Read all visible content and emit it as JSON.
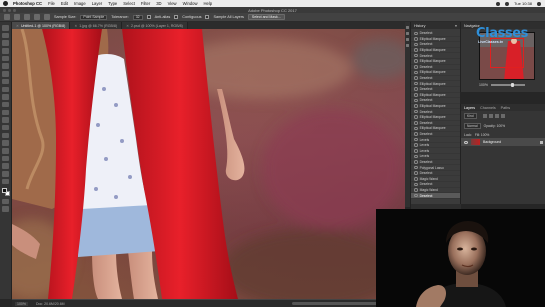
{
  "menubar": {
    "app_name": "Photoshop CC",
    "items": [
      "File",
      "Edit",
      "Image",
      "Layer",
      "Type",
      "Select",
      "Filter",
      "3D",
      "View",
      "Window",
      "Help"
    ],
    "clock": "Tue 10:38"
  },
  "window": {
    "title": "Adobe Photoshop CC 2017"
  },
  "options_bar": {
    "sample_label": "Sample Size:",
    "sample_value": "Point Sample",
    "tolerance_label": "Tolerance:",
    "tolerance_value": "32",
    "antialias_label": "Anti-alias",
    "contiguous_label": "Contiguous",
    "sample_all_label": "Sample All Layers",
    "select_mask_label": "Select and Mask..."
  },
  "document_tabs": [
    {
      "label": "Untitled-1 @ 100% (RGB/8)",
      "active": true
    },
    {
      "label": "1.jpg @ 66.7% (RGB/8)",
      "active": false
    },
    {
      "label": "2.psd @ 100% (Layer 1, RGB/8)",
      "active": false
    }
  ],
  "status_bar": {
    "zoom": "100%",
    "doc": "Doc: 20.6M/20.6M"
  },
  "history": {
    "title": "History",
    "rows": [
      "Deselect",
      "Elliptical Marquee",
      "Deselect",
      "Elliptical Marquee",
      "Deselect",
      "Elliptical Marquee",
      "Deselect",
      "Elliptical Marquee",
      "Deselect",
      "Elliptical Marquee",
      "Deselect",
      "Elliptical Marquee",
      "Deselect",
      "Elliptical Marquee",
      "Deselect",
      "Elliptical Marquee",
      "Deselect",
      "Elliptical Marquee",
      "Deselect",
      "Levels",
      "Levels",
      "Levels",
      "Levels",
      "Deselect",
      "Polygonal Lasso",
      "Deselect",
      "Magic Wand",
      "Deselect",
      "Magic Wand",
      "Deselect"
    ],
    "active_index": 29
  },
  "navigator": {
    "title": "Navigator",
    "zoom": "100%"
  },
  "logo": {
    "brand": "Classes",
    "sub": "LiveClasses.tv"
  },
  "layers": {
    "tabs": [
      "Layers",
      "Channels",
      "Paths"
    ],
    "kind_label": "Kind",
    "blend_mode": "Normal",
    "opacity_label": "Opacity: 100%",
    "lock_label": "Lock:",
    "fill_label": "Fill: 100%",
    "layer_name": "Background"
  },
  "colors": {
    "accent_blue": "#2f8fd8",
    "dress_red": "#e0202a"
  }
}
